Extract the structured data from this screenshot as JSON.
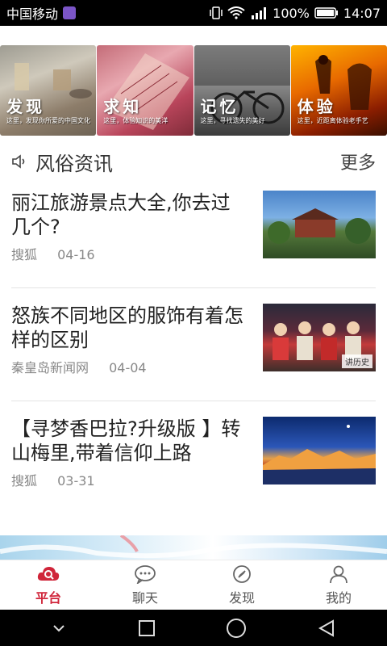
{
  "status_bar": {
    "carrier": "中国移动",
    "battery": "100%",
    "time": "14:07"
  },
  "banner": {
    "tiles": [
      {
        "title": "发现",
        "subtitle": "这里，发现你所爱的中国文化"
      },
      {
        "title": "求知",
        "subtitle": "这里，体验知识的美洋"
      },
      {
        "title": "记忆",
        "subtitle": "这里，寻找遗失的美好"
      },
      {
        "title": "体验",
        "subtitle": "这里，近距离体验老手艺"
      }
    ]
  },
  "section": {
    "title": "风俗资讯",
    "more": "更多"
  },
  "news": [
    {
      "headline": "丽江旅游景点大全,你去过几个?",
      "source": "搜狐",
      "date": "04-16"
    },
    {
      "headline": "怒族不同地区的服饰有着怎样的区别",
      "source": "秦皇岛新闻网",
      "date": "04-04",
      "thumb_tag": "讲历史"
    },
    {
      "headline": "【寻梦香巴拉?升级版 】转山梅里,带着信仰上路",
      "source": "搜狐",
      "date": "03-31"
    }
  ],
  "bottom_nav": {
    "items": [
      {
        "label": "平台",
        "icon": "cloud-search-icon",
        "active": true
      },
      {
        "label": "聊天",
        "icon": "chat-bubble-icon",
        "active": false
      },
      {
        "label": "发现",
        "icon": "compass-icon",
        "active": false
      },
      {
        "label": "我的",
        "icon": "person-icon",
        "active": false
      }
    ]
  },
  "colors": {
    "accent": "#d0253a",
    "text": "#222222",
    "muted": "#888888"
  }
}
